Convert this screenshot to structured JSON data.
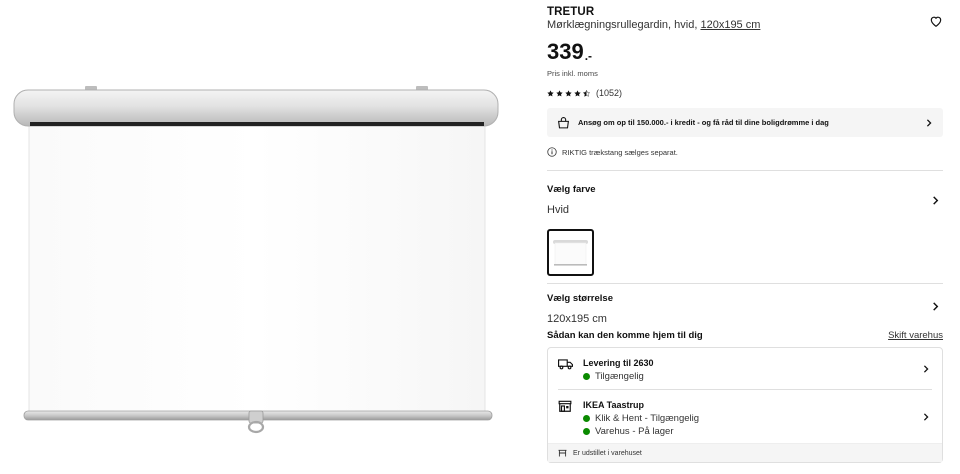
{
  "product": {
    "name": "TRETUR",
    "description": "Mørklægningsrullegardin, hvid,",
    "size_link": "120x195 cm",
    "price": "339",
    "price_suffix": ".-",
    "vat_note": "Pris inkl. moms",
    "rating_value": 4.5,
    "rating_count": "(1052)"
  },
  "credit_banner": {
    "text": "Ansøg om op til 150.000.- i kredit - og få råd til dine boligdrømme i dag",
    "icon": "shopping-bag-icon"
  },
  "note": {
    "text": "RIKTIG trækstang sælges separat.",
    "icon": "info-icon"
  },
  "color_option": {
    "title": "Vælg farve",
    "value": "Hvid"
  },
  "size_option": {
    "title": "Vælg størrelse",
    "value": "120x195 cm"
  },
  "delivery": {
    "title": "Sådan kan den komme hjem til dig",
    "change_store": "Skift varehus",
    "home": {
      "title": "Levering til 2630",
      "status": "Tilgængelig",
      "icon": "truck-icon"
    },
    "store": {
      "title": "IKEA Taastrup",
      "status1": "Klik & Hent - Tilgængelig",
      "status2": "Varehus - På lager",
      "icon": "store-icon"
    },
    "footer": "Er udstillet i varehuset"
  },
  "colors": {
    "status_green": "#0a8a00"
  }
}
